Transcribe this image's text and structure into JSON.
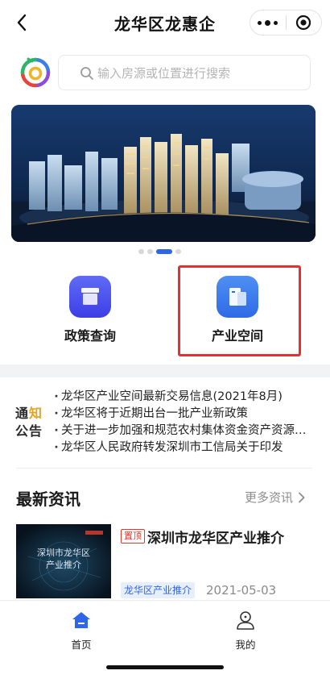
{
  "navbar": {
    "title": "龙华区龙惠企",
    "back_icon": "chevron-left-icon",
    "more_icon": "more-dots-icon",
    "close_icon": "target-close-icon"
  },
  "search": {
    "placeholder": "输入房源或位置进行搜索",
    "value": "",
    "icon": "search-icon"
  },
  "banner": {
    "pages": 4,
    "active_page": 3
  },
  "entries": [
    {
      "label": "政策查询",
      "icon": "document-box-icon"
    },
    {
      "label": "产业空间",
      "icon": "building-card-icon"
    }
  ],
  "notice": {
    "title_line1_a": "通",
    "title_line1_b": "知",
    "title_line2": "公告",
    "items": [
      "龙华区产业空间最新交易信息(2021年8月)",
      "龙华区将于近期出台一批产业新政策",
      "关于进一步加强和规范农村集体资金资产资源管理的通知",
      "龙华区人民政府转发深圳市工信局关于印发"
    ]
  },
  "news": {
    "section_title": "最新资讯",
    "more_label": "更多资讯",
    "items": [
      {
        "pin": "置顶",
        "title": "深圳市龙华区产业推介",
        "tag": "龙华区产业推介",
        "date": "2021-05-03",
        "thumb_title": "深圳市龙华区",
        "thumb_subtitle": "产业推介"
      }
    ]
  },
  "tabbar": {
    "items": [
      {
        "label": "首页",
        "icon": "home-icon",
        "active": true
      },
      {
        "label": "我的",
        "icon": "user-icon",
        "active": false
      }
    ]
  },
  "colors": {
    "accent": "#2f66e8",
    "highlight": "#e53030",
    "pin": "#e03a2f",
    "notice_accent": "#e6a21e"
  }
}
